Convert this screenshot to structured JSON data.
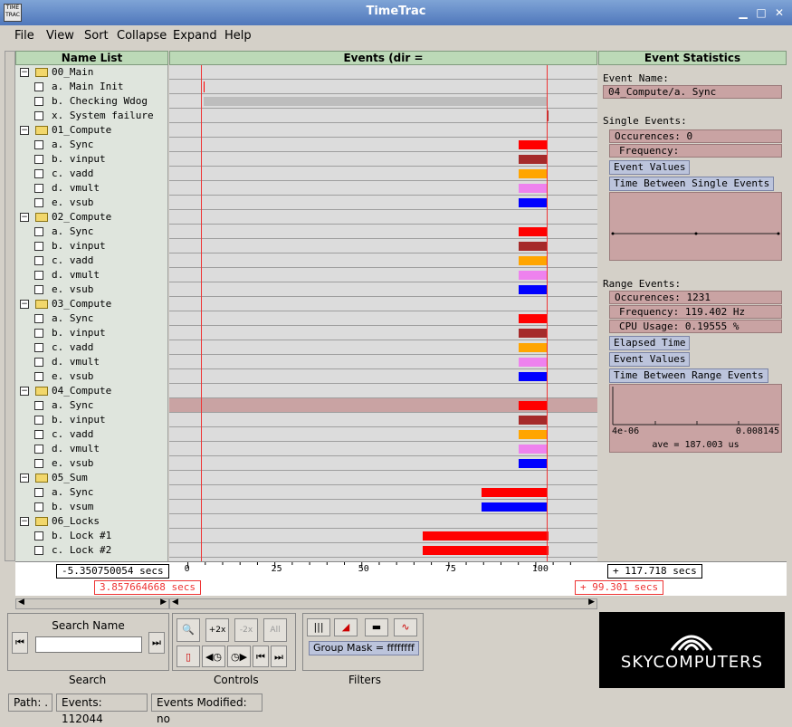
{
  "window": {
    "title": "TimeTrac",
    "icon_text": "TIME TRAC"
  },
  "menu": [
    "File",
    "View",
    "Sort",
    "Collapse",
    "Expand",
    "Help"
  ],
  "name_list_header": "Name List",
  "events_header": "Events (dir = /net/users/Eng/jackson/sw_prod/TimeTrac/examples/locks)",
  "stats_header": "Event Statistics",
  "tree": [
    {
      "type": "group",
      "label": "00_Main"
    },
    {
      "type": "item",
      "label": "a. Main Init"
    },
    {
      "type": "item",
      "label": "b. Checking Wdog"
    },
    {
      "type": "item",
      "label": "x. System failure"
    },
    {
      "type": "group",
      "label": "01_Compute"
    },
    {
      "type": "item",
      "label": "a. Sync"
    },
    {
      "type": "item",
      "label": "b. vinput"
    },
    {
      "type": "item",
      "label": "c. vadd"
    },
    {
      "type": "item",
      "label": "d. vmult"
    },
    {
      "type": "item",
      "label": "e. vsub"
    },
    {
      "type": "group",
      "label": "02_Compute"
    },
    {
      "type": "item",
      "label": "a. Sync"
    },
    {
      "type": "item",
      "label": "b. vinput"
    },
    {
      "type": "item",
      "label": "c. vadd"
    },
    {
      "type": "item",
      "label": "d. vmult"
    },
    {
      "type": "item",
      "label": "e. vsub"
    },
    {
      "type": "group",
      "label": "03_Compute"
    },
    {
      "type": "item",
      "label": "a. Sync"
    },
    {
      "type": "item",
      "label": "b. vinput"
    },
    {
      "type": "item",
      "label": "c. vadd"
    },
    {
      "type": "item",
      "label": "d. vmult"
    },
    {
      "type": "item",
      "label": "e. vsub"
    },
    {
      "type": "group",
      "label": "04_Compute"
    },
    {
      "type": "item",
      "label": "a. Sync"
    },
    {
      "type": "item",
      "label": "b. vinput"
    },
    {
      "type": "item",
      "label": "c. vadd"
    },
    {
      "type": "item",
      "label": "d. vmult"
    },
    {
      "type": "item",
      "label": "e. vsub"
    },
    {
      "type": "group",
      "label": "05_Sum"
    },
    {
      "type": "item",
      "label": "a. Sync"
    },
    {
      "type": "item",
      "label": "b. vsum"
    },
    {
      "type": "group",
      "label": "06_Locks"
    },
    {
      "type": "item",
      "label": "b. Lock #1"
    },
    {
      "type": "item",
      "label": "c. Lock #2"
    }
  ],
  "colors": {
    "sync": "#ff0000",
    "vinput": "#a52a2a",
    "vadd": "#ffa500",
    "vmult": "#ee82ee",
    "vsub": "#0000ff",
    "wdog": "#bdbdbd",
    "marker": "#e33333"
  },
  "event_bars": [
    {
      "row": 1,
      "start": 4.5,
      "end": 4.8,
      "color": "sync"
    },
    {
      "row": 2,
      "start": 4.5,
      "end": 103.5,
      "color": "wdog"
    },
    {
      "row": 3,
      "start": 103.5,
      "end": 103.8,
      "color": "vinput"
    },
    {
      "row": 5,
      "start": 95,
      "end": 103.5,
      "color": "sync"
    },
    {
      "row": 6,
      "start": 95,
      "end": 103.5,
      "color": "vinput"
    },
    {
      "row": 7,
      "start": 95,
      "end": 103.5,
      "color": "vadd"
    },
    {
      "row": 8,
      "start": 95,
      "end": 103.5,
      "color": "vmult"
    },
    {
      "row": 9,
      "start": 95,
      "end": 103.5,
      "color": "vsub"
    },
    {
      "row": 11,
      "start": 95,
      "end": 103.5,
      "color": "sync"
    },
    {
      "row": 12,
      "start": 95,
      "end": 103.5,
      "color": "vinput"
    },
    {
      "row": 13,
      "start": 95,
      "end": 103.5,
      "color": "vadd"
    },
    {
      "row": 14,
      "start": 95,
      "end": 103.5,
      "color": "vmult"
    },
    {
      "row": 15,
      "start": 95,
      "end": 103.5,
      "color": "vsub"
    },
    {
      "row": 17,
      "start": 95,
      "end": 103.5,
      "color": "sync"
    },
    {
      "row": 18,
      "start": 95,
      "end": 103.5,
      "color": "vinput"
    },
    {
      "row": 19,
      "start": 95,
      "end": 103.5,
      "color": "vadd"
    },
    {
      "row": 20,
      "start": 95,
      "end": 103.5,
      "color": "vmult"
    },
    {
      "row": 21,
      "start": 95,
      "end": 103.5,
      "color": "vsub"
    },
    {
      "row": 23,
      "start": 95,
      "end": 103.5,
      "color": "sync"
    },
    {
      "row": 24,
      "start": 95,
      "end": 103.5,
      "color": "vinput"
    },
    {
      "row": 25,
      "start": 95,
      "end": 103.5,
      "color": "vadd"
    },
    {
      "row": 26,
      "start": 95,
      "end": 103.5,
      "color": "vmult"
    },
    {
      "row": 27,
      "start": 95,
      "end": 103.5,
      "color": "vsub"
    },
    {
      "row": 29,
      "start": 84.5,
      "end": 103.5,
      "color": "sync"
    },
    {
      "row": 30,
      "start": 84.5,
      "end": 103.5,
      "color": "vsub"
    },
    {
      "row": 32,
      "start": 67.5,
      "end": 103.8,
      "color": "sync"
    },
    {
      "row": 33,
      "start": 67.5,
      "end": 103.8,
      "color": "sync"
    }
  ],
  "selected_row": 23,
  "axis": {
    "ticks": [
      "0",
      "25",
      "50",
      "75",
      "100"
    ],
    "tick_values": [
      0,
      25,
      50,
      75,
      100
    ],
    "view_start": -5.350750054,
    "view_end": 117.718,
    "start_readout": "-5.350750054 secs",
    "end_readout": "+ 117.718 secs",
    "marker_left_value": 3.857664668,
    "marker_right_value": 103.159,
    "marker_left_readout": "3.857664668 secs",
    "marker_right_readout": "+ 99.301 secs"
  },
  "stats": {
    "event_name_label": "Event Name:",
    "event_name": "04_Compute/a. Sync",
    "single_label": "Single Events:",
    "single_occurences": "Occurences: 0",
    "single_frequency": "Frequency:",
    "event_values_btn": "Event Values",
    "time_between_single_btn": "Time Between Single Events",
    "range_label": "Range Events:",
    "range_occurences": "Occurences: 1231",
    "range_frequency": "Frequency: 119.402 Hz",
    "cpu_usage": "CPU Usage: 0.19555 %",
    "elapsed_time_btn": "Elapsed Time",
    "range_event_values_btn": "Event Values",
    "time_between_range_btn": "Time Between Range Events",
    "hist_min": "4e-06",
    "hist_max": "0.008145",
    "hist_ave": "ave = 187.003 us"
  },
  "search": {
    "title": "Search Name",
    "caption": "Search",
    "value": ""
  },
  "controls": {
    "caption": "Controls",
    "zoom_in_label": "+2x",
    "zoom_out_label": "-2x",
    "all_label": "All"
  },
  "filters": {
    "caption": "Filters",
    "group_mask": "Group Mask = ffffffff"
  },
  "logo": {
    "text": "SKYCOMPUTERS"
  },
  "status": {
    "path": "Path: .",
    "events": "Events: 112044",
    "modified": "Events Modified: no"
  }
}
